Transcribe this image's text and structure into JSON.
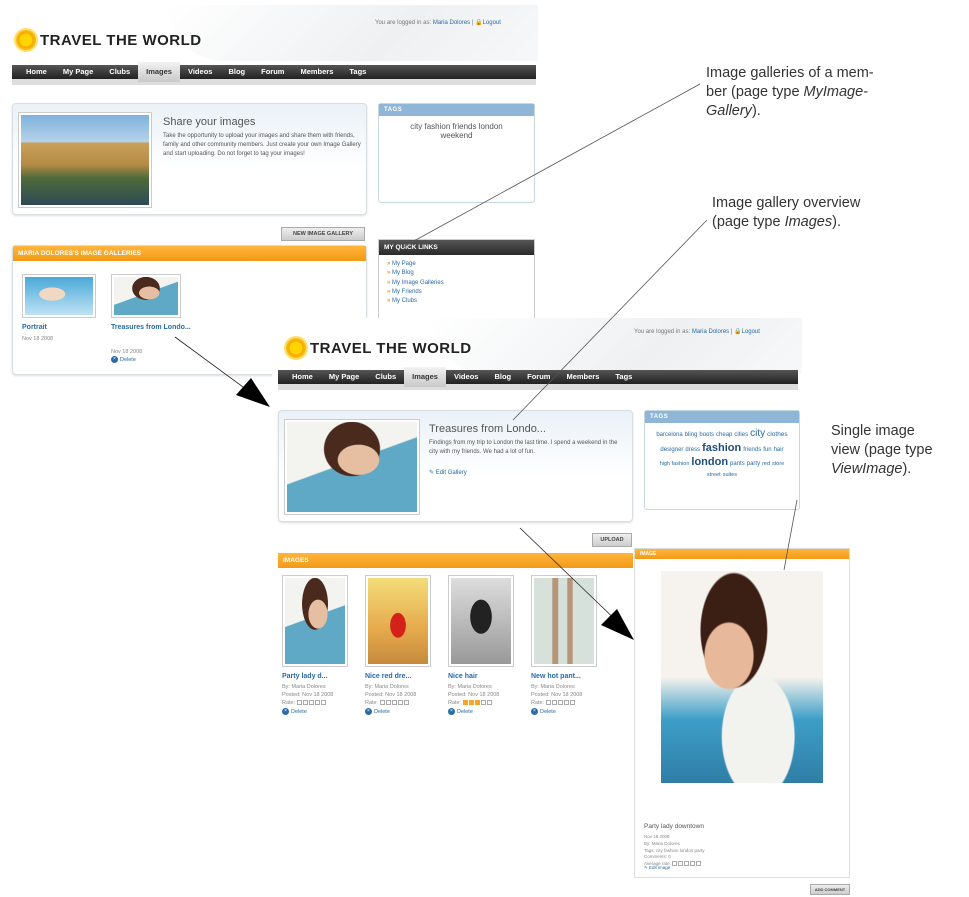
{
  "app": {
    "logo_text": "TRAVEL THE WORLD"
  },
  "login": {
    "prefix": "You are logged in as:",
    "user": "Maria Dolores",
    "separator": "|",
    "logout": "Logout"
  },
  "nav": [
    "Home",
    "My Page",
    "Clubs",
    "Images",
    "Videos",
    "Blog",
    "Forum",
    "Members",
    "Tags"
  ],
  "nav_active": "Images",
  "screen1": {
    "title": "Share your images",
    "text": "Take the opportunity to upload your images and share them with friends, family and other community members. Just create your own Image Gallery and start uploading. Do not forget to tag your images!",
    "tags_header": "TAGS",
    "tags": "city fashion friends london weekend",
    "new_gallery_button": "NEW IMAGE GALLERY",
    "galleries_header": "MARIA DOLORES'S IMAGE GALLERIES",
    "galleries": [
      {
        "title": "Portrait",
        "date": "Nov 18 2008"
      },
      {
        "title": "Treasures from Londo...",
        "date": "Nov 18 2008",
        "delete": "Delete"
      }
    ],
    "quicklinks_header": "MY QUICK LINKS",
    "quicklinks": [
      "My Page",
      "My Blog",
      "My Image Galleries",
      "My Friends",
      "My Clubs"
    ]
  },
  "screen2": {
    "title": "Treasures from Londo...",
    "text": "Findings from my trip to London the last time. I spend a weekend in the city with my friends. We had a lot of fun.",
    "edit_gallery": "Edit Gallery",
    "tags_header": "TAGS",
    "tag_cloud": [
      "barcelona",
      "bling",
      "boots",
      "cheap",
      "cities",
      "city",
      "clothes",
      "designer",
      "dress",
      "fashion",
      "friends",
      "fun",
      "hair",
      "high fashion",
      "london",
      "pants",
      "party",
      "red",
      "store",
      "street",
      "suites"
    ],
    "upload_button": "UPLOAD",
    "images_header": "IMAGES",
    "images": [
      {
        "title": "Party lady d...",
        "by": "By: Maria Dolores",
        "posted": "Posted: Nov 18 2008",
        "rate_label": "Rate:",
        "rating": 0,
        "delete": "Delete"
      },
      {
        "title": "Nice red dre...",
        "by": "By: Maria Dolores",
        "posted": "Posted: Nov 18 2008",
        "rate_label": "Rate:",
        "rating": 0,
        "delete": "Delete"
      },
      {
        "title": "Nice hair",
        "by": "By: Maria Dolores",
        "posted": "Posted: Nov 18 2008",
        "rate_label": "Rate:",
        "rating": 3,
        "delete": "Delete"
      },
      {
        "title": "New hot pant...",
        "by": "By: Maria Dolores",
        "posted": "Posted: Nov 18 2008",
        "rate_label": "Rate:",
        "rating": 0,
        "delete": "Delete"
      }
    ]
  },
  "screen3": {
    "header": "IMAGE",
    "caption": "Party lady downtown",
    "details": [
      "Nov 18 2008",
      "By: Maria Dolores",
      "Tags: city fashion london party",
      "Comments: 0",
      "Average rate:"
    ],
    "edit_image": "Edit image",
    "button": "ADD COMMENT"
  },
  "annotations": {
    "a1": [
      "Image galleries of a mem-",
      "ber (page type ",
      "MyImage-",
      "Gallery",
      ")."
    ],
    "a2": [
      "Image gallery overview",
      "(page type ",
      "Images",
      ")."
    ],
    "a3": [
      "Single image",
      "view (page type",
      "ViewImage",
      ")."
    ]
  }
}
